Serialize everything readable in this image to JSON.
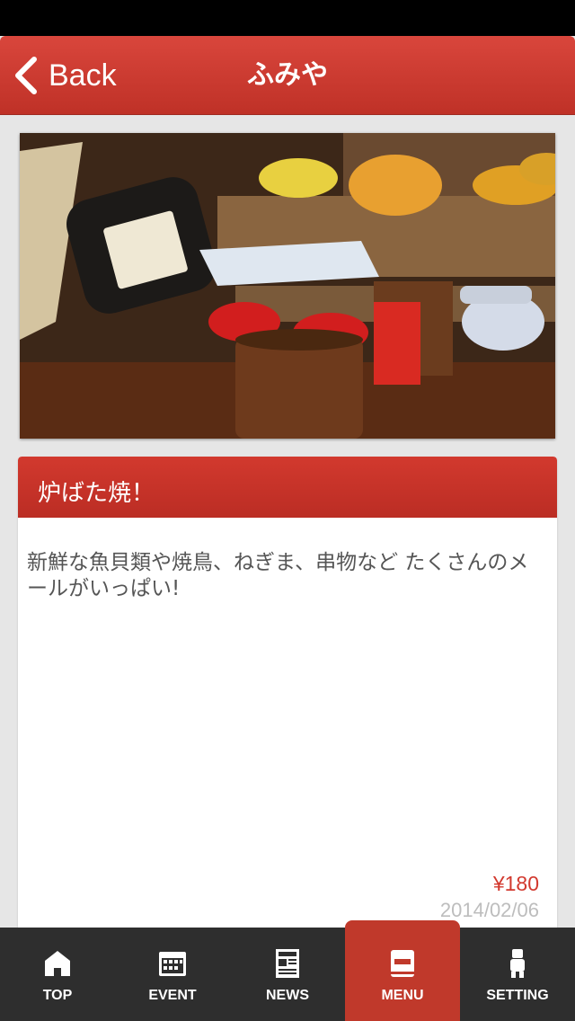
{
  "nav": {
    "back_label": "Back",
    "title": "ふみや"
  },
  "item": {
    "title": "炉ばた焼！",
    "description": "新鮮な魚貝類や焼鳥、ねぎま、串物など たくさんのメールがいっぱい!",
    "price": "¥180",
    "date": "2014/02/06"
  },
  "tabs": [
    {
      "label": "TOP",
      "icon": "home-icon"
    },
    {
      "label": "EVENT",
      "icon": "calendar-icon"
    },
    {
      "label": "NEWS",
      "icon": "newspaper-icon"
    },
    {
      "label": "MENU",
      "icon": "menu-book-icon",
      "active": true
    },
    {
      "label": "SETTING",
      "icon": "person-icon"
    }
  ],
  "colors": {
    "accent": "#c0392b",
    "tabbar": "#2e2e2e",
    "background": "#e6e6e6",
    "price": "#d2392e"
  }
}
